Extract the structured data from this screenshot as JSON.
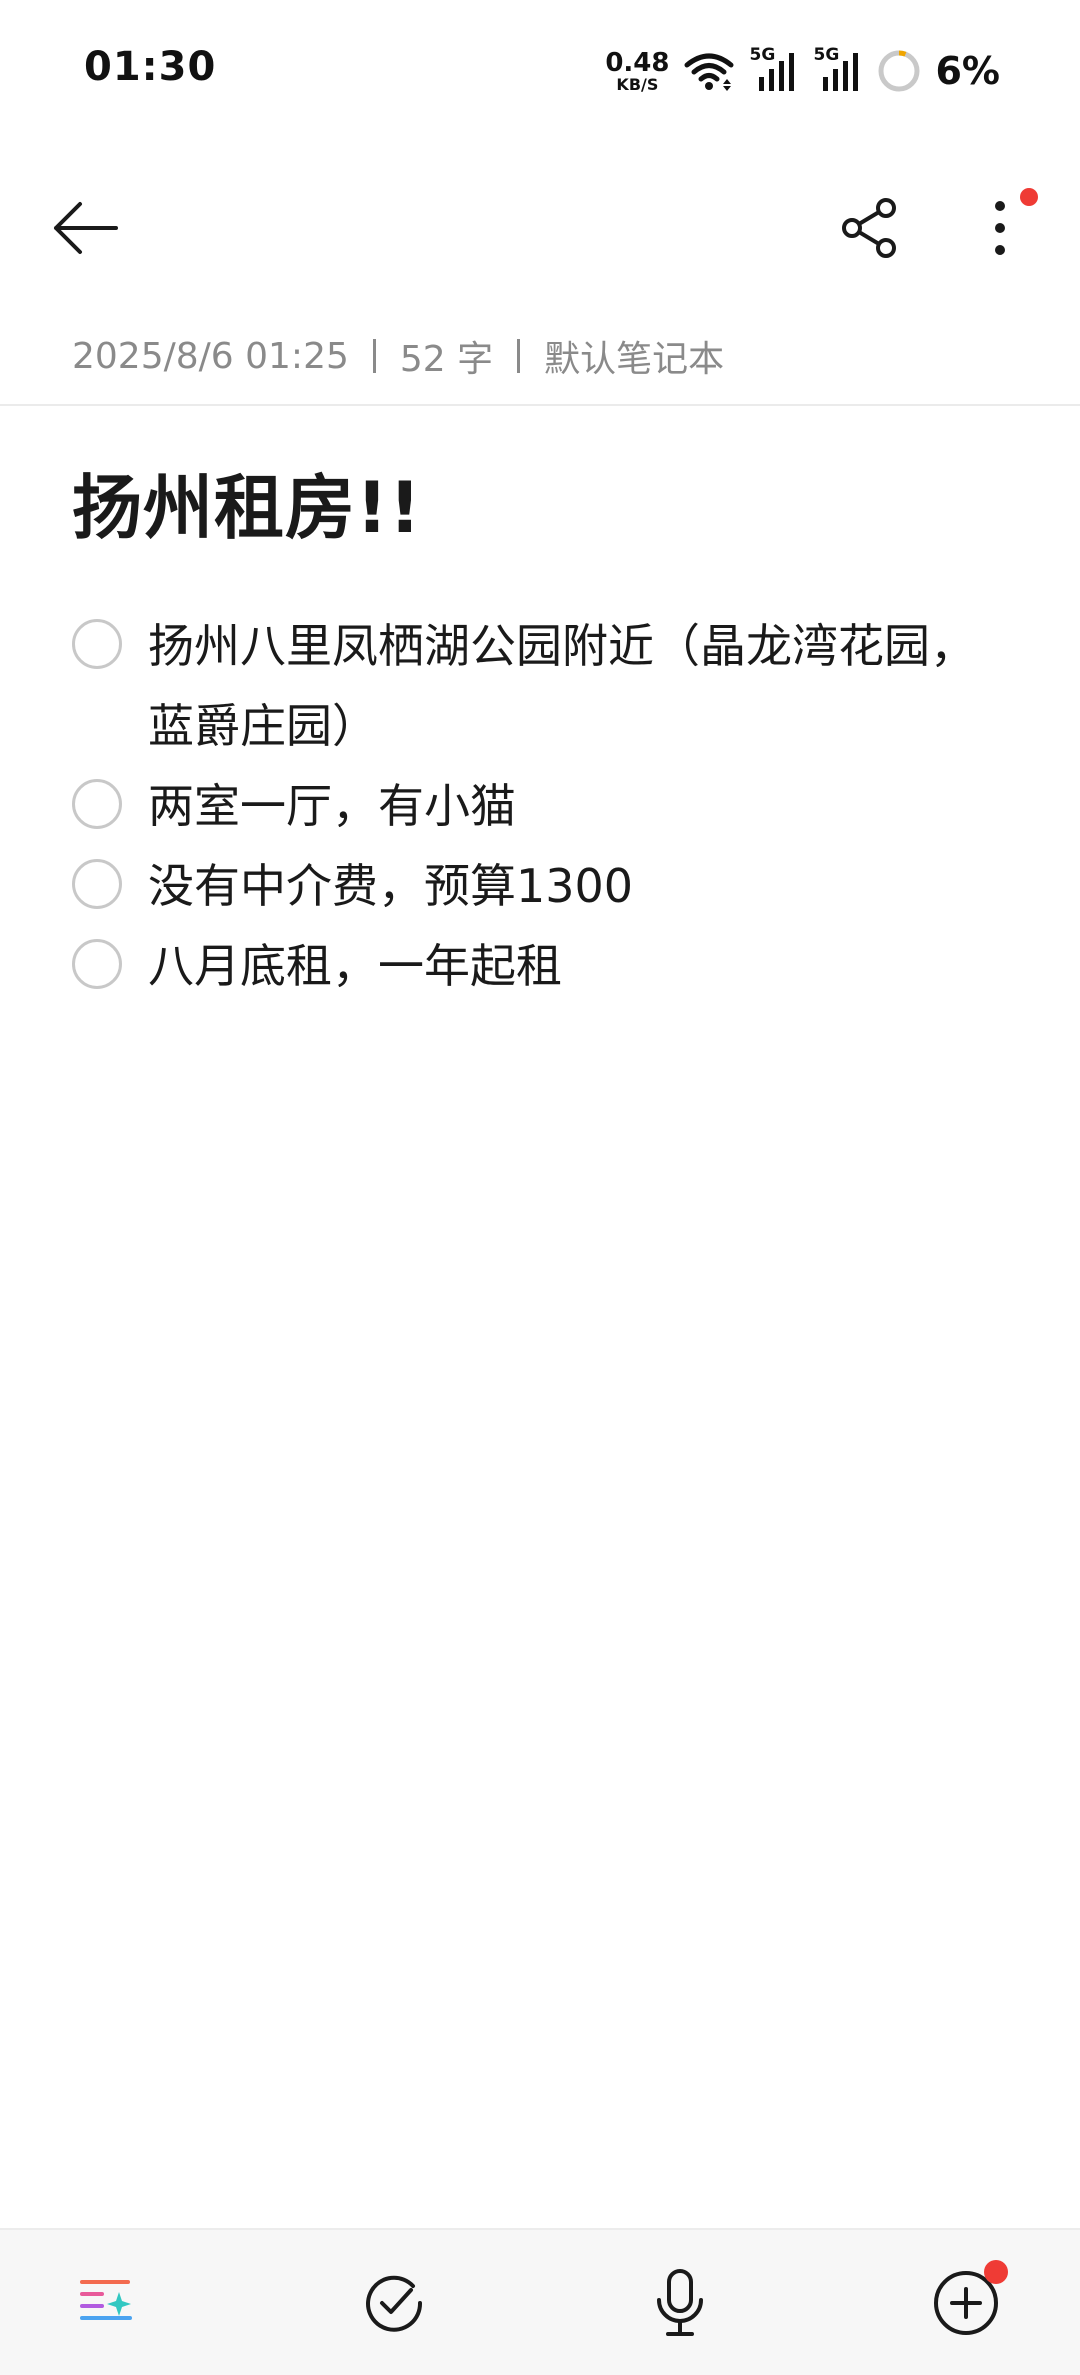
{
  "status_bar": {
    "time": "01:30",
    "net_speed_value": "0.48",
    "net_speed_unit": "KB/S",
    "sim1_label": "5G",
    "sim2_label": "5G",
    "battery_percent": "6%",
    "battery_level": 0.06,
    "icons": [
      "wifi-icon",
      "signal-icon",
      "signal-icon",
      "battery-ring-icon"
    ]
  },
  "toolbar": {
    "back_icon": "arrow-left-icon",
    "share_icon": "share-icon",
    "more_icon": "more-vertical-icon",
    "notification_dot_color": "#ef3b35"
  },
  "meta": {
    "date": "2025/8/6 01:25",
    "word_count": "52 字",
    "notebook": "默认笔记本"
  },
  "note": {
    "title": "扬州租房!!",
    "items": [
      {
        "text": "扬州八里凤栖湖公园附近（晶龙湾花园，蓝爵庄园）",
        "checked": false
      },
      {
        "text": "两室一厅，有小猫",
        "checked": false
      },
      {
        "text": "没有中介费，预算1300",
        "checked": false
      },
      {
        "text": "八月底租，一年起租",
        "checked": false
      }
    ]
  },
  "bottom_bar": {
    "icons": [
      "ai-format-icon",
      "checklist-icon",
      "microphone-icon",
      "add-circle-icon"
    ]
  }
}
